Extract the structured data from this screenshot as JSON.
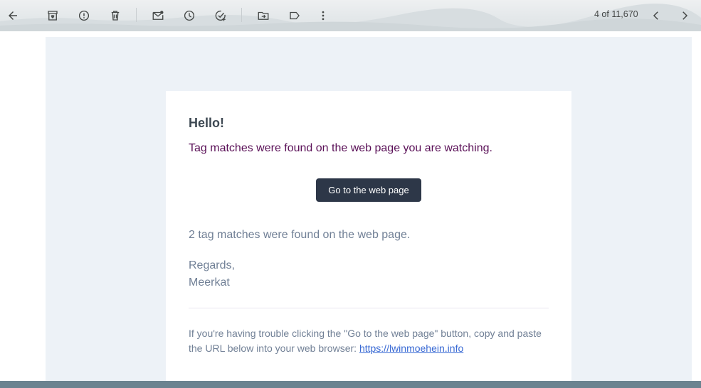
{
  "toolbar": {
    "buttons": [
      {
        "name": "back-button",
        "icon": "arrow-left-icon"
      },
      {
        "name": "archive-button",
        "icon": "archive-icon"
      },
      {
        "name": "report-spam-button",
        "icon": "report-icon"
      },
      {
        "name": "delete-button",
        "icon": "trash-icon"
      },
      {
        "name": "mark-unread-button",
        "icon": "mail-unread-icon"
      },
      {
        "name": "snooze-button",
        "icon": "clock-icon"
      },
      {
        "name": "add-to-tasks-button",
        "icon": "task-add-icon"
      },
      {
        "name": "move-to-button",
        "icon": "folder-move-icon"
      },
      {
        "name": "labels-button",
        "icon": "label-icon"
      },
      {
        "name": "more-button",
        "icon": "more-vert-icon"
      }
    ],
    "counter": "4 of 11,670",
    "prev_icon": "chevron-left-icon",
    "next_icon": "chevron-right-icon"
  },
  "email": {
    "brand": "Meerkat",
    "greeting": "Hello!",
    "intro": "Tag matches were found on the web page you are watching.",
    "cta_label": "Go to the web page",
    "summary": "2 tag matches were found on the web page.",
    "regards_line1": "Regards,",
    "regards_line2": "Meerkat",
    "subcopy_text": "If you're having trouble clicking the \"Go to the web page\" button, copy and paste the URL below into your web browser: ",
    "subcopy_link": "https://lwinmoehein.info"
  },
  "colors": {
    "panel_bg": "#edf2f7",
    "button_bg": "#2d3748",
    "intro_text": "#5a1057",
    "muted_text": "#718096",
    "link": "#3869d4"
  }
}
